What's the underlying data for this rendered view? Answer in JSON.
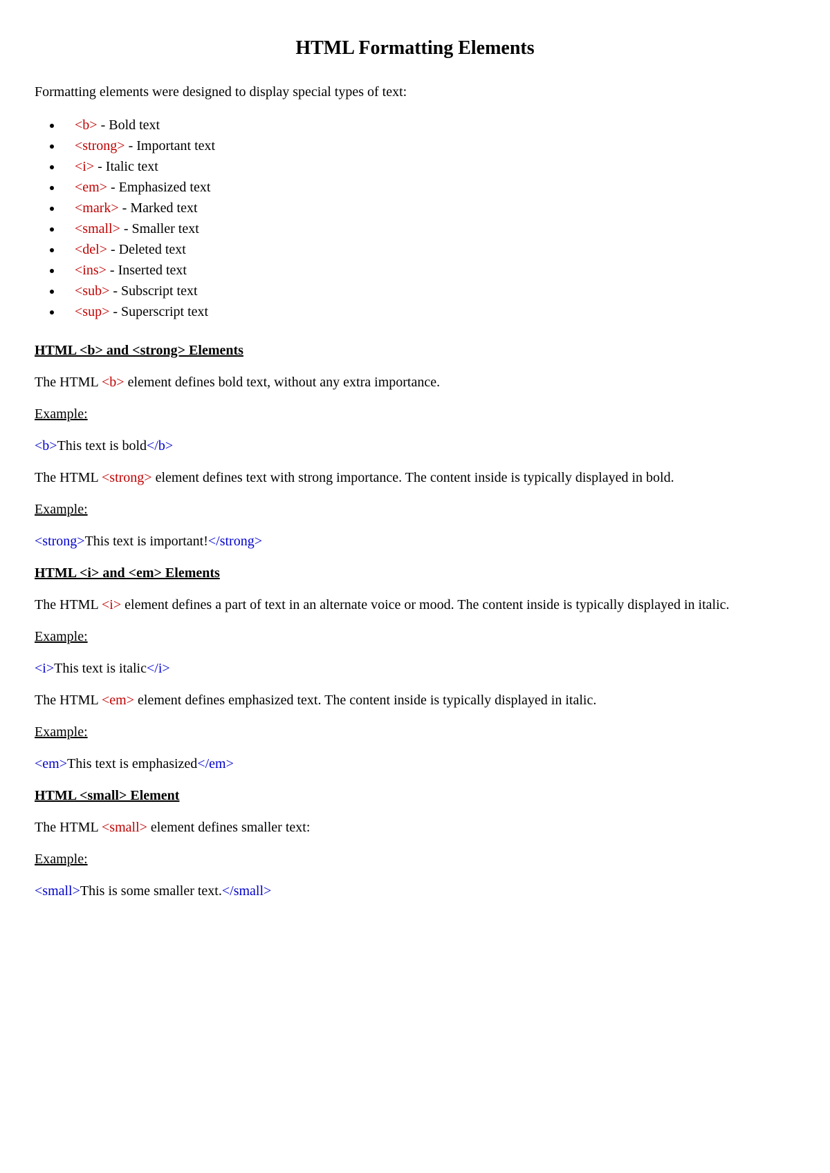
{
  "title": "HTML Formatting Elements",
  "intro": "Formatting elements were designed to display special types of text:",
  "list": [
    {
      "tag": "<b>",
      "desc": " - Bold text"
    },
    {
      "tag": "<strong>",
      "desc": " - Important text"
    },
    {
      "tag": "<i>",
      "desc": " - Italic text"
    },
    {
      "tag": "<em>",
      "desc": " - Emphasized text"
    },
    {
      "tag": "<mark>",
      "desc": " - Marked text"
    },
    {
      "tag": "<small>",
      "desc": " - Smaller text"
    },
    {
      "tag": "<del>",
      "desc": " - Deleted text"
    },
    {
      "tag": "<ins>",
      "desc": " - Inserted text"
    },
    {
      "tag": "<sub>",
      "desc": " - Subscript text"
    },
    {
      "tag": "<sup>",
      "desc": " - Superscript text"
    }
  ],
  "section1": {
    "heading": "HTML <b> and <strong> Elements",
    "p1a": "The HTML ",
    "p1tag": "<b>",
    "p1b": " element defines bold text, without any extra importance.",
    "exampleLabel": "Example:",
    "codeOpen": "<b>",
    "codeText": "This text is bold",
    "codeClose": "</b>",
    "p2a": "The HTML ",
    "p2tag": "<strong>",
    "p2b": " element defines text with strong importance. The content inside is typically displayed in bold.",
    "code2Open": "<strong>",
    "code2Text": "This text is important!",
    "code2Close": "</strong>"
  },
  "section2": {
    "heading": "HTML <i> and <em> Elements",
    "p1a": "The HTML ",
    "p1tag": "<i>",
    "p1b": " element defines a part of text in an alternate voice or mood. The content inside is typically displayed in italic.",
    "exampleLabel": "Example:",
    "codeOpen": "<i>",
    "codeText": "This text is italic",
    "codeClose": "</i>",
    "p2a": "The HTML ",
    "p2tag": "<em>",
    "p2b": " element defines emphasized text. The content inside is typically displayed in italic.",
    "code2Open": "<em>",
    "code2Text": "This text is emphasized",
    "code2Close": "</em>"
  },
  "section3": {
    "heading": "HTML <small> Element",
    "p1a": "The HTML ",
    "p1tag": "<small>",
    "p1b": " element defines smaller text:",
    "exampleLabel": "Example:",
    "codeOpen": "<small>",
    "codeText": "This is some smaller text.",
    "codeClose": "</small>"
  }
}
